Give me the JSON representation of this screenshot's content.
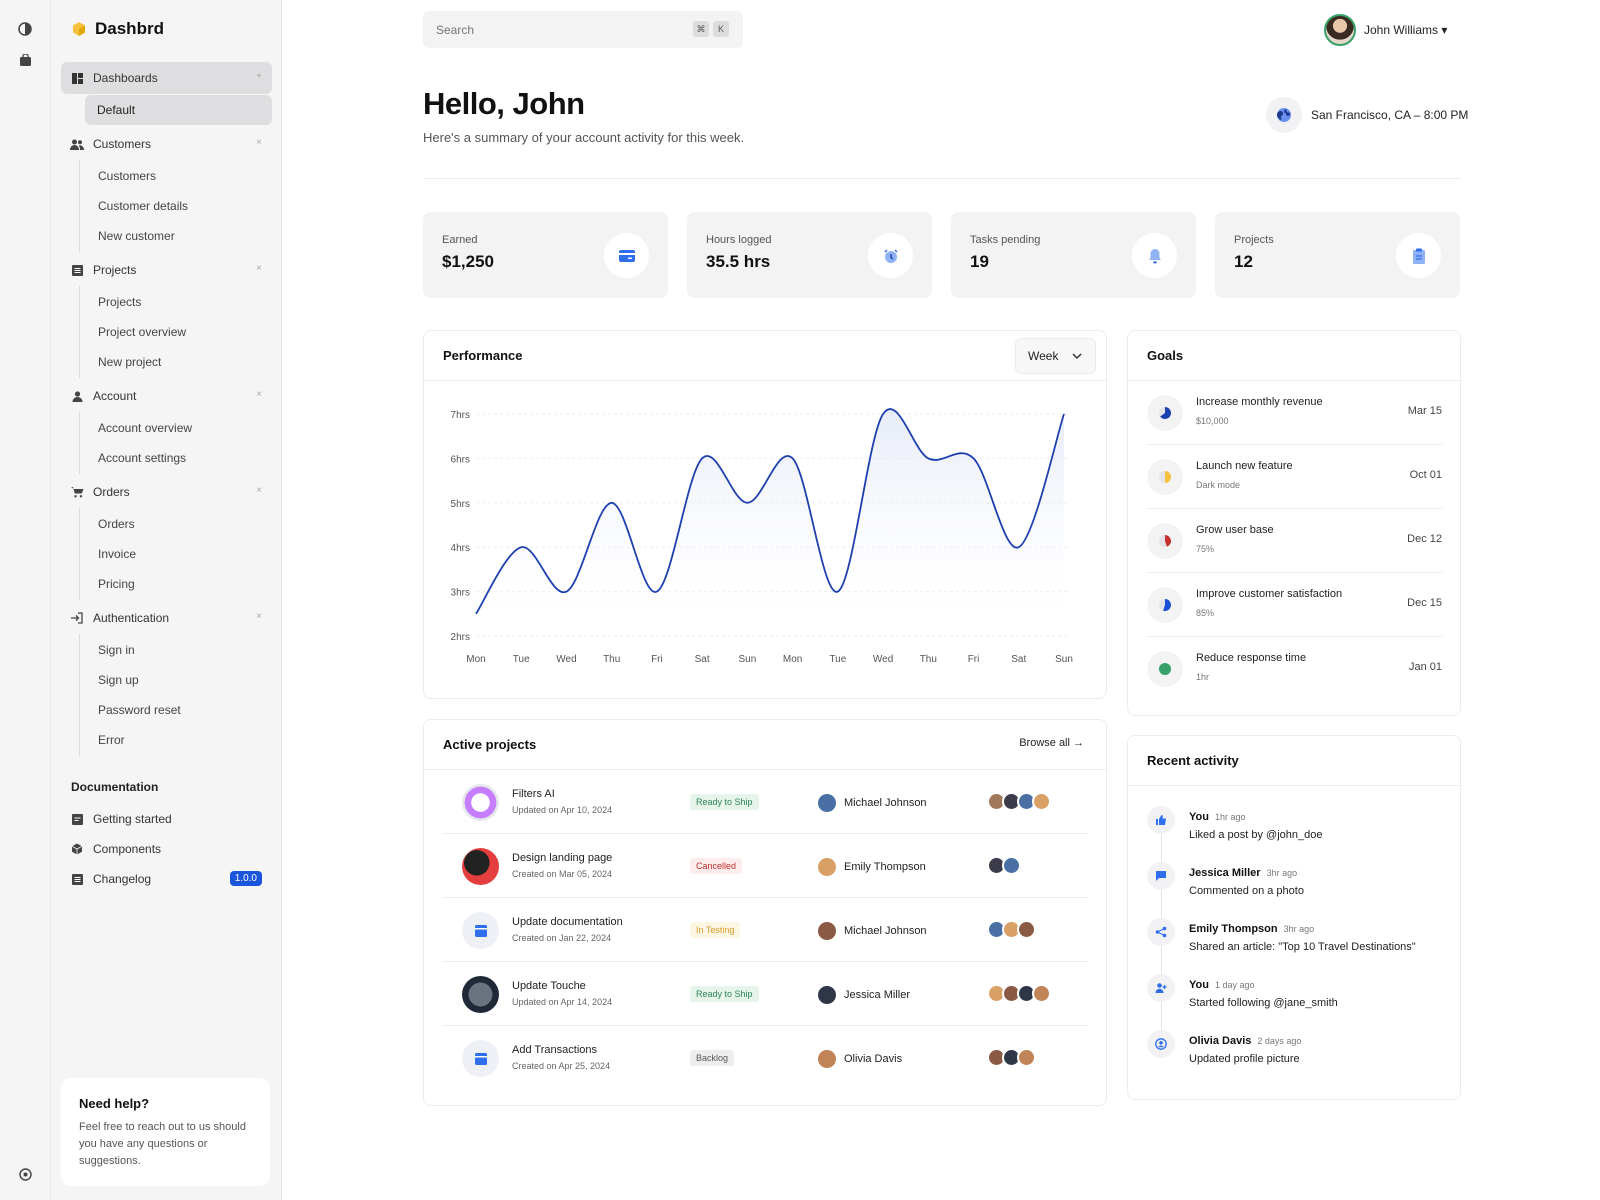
{
  "brand": {
    "name": "Dashbrd"
  },
  "search": {
    "placeholder": "Search",
    "key1": "⌘",
    "key2": "K"
  },
  "user": {
    "name": "John Williams ▾"
  },
  "sidebar": {
    "groups": [
      {
        "label": "Dashboards",
        "items": [
          "Default"
        ]
      },
      {
        "label": "Customers",
        "items": [
          "Customers",
          "Customer details",
          "New customer"
        ]
      },
      {
        "label": "Projects",
        "items": [
          "Projects",
          "Project overview",
          "New project"
        ]
      },
      {
        "label": "Account",
        "items": [
          "Account overview",
          "Account settings"
        ]
      },
      {
        "label": "Orders",
        "items": [
          "Orders",
          "Invoice",
          "Pricing"
        ]
      },
      {
        "label": "Authentication",
        "items": [
          "Sign in",
          "Sign up",
          "Password reset",
          "Error"
        ]
      }
    ],
    "docs_title": "Documentation",
    "docs": [
      "Getting started",
      "Components",
      "Changelog"
    ],
    "changelog_badge": "1.0.0",
    "help_title": "Need help?",
    "help_text": "Feel free to reach out to us should you have any questions or suggestions."
  },
  "header": {
    "title": "Hello, John",
    "subtitle": "Here's a summary of your account activity for this week.",
    "location": "San Francisco, CA – 8:00 PM"
  },
  "stats": [
    {
      "label": "Earned",
      "value": "$1,250",
      "icon": "card-icon"
    },
    {
      "label": "Hours logged",
      "value": "35.5 hrs",
      "icon": "clock-icon"
    },
    {
      "label": "Tasks pending",
      "value": "19",
      "icon": "bell-icon"
    },
    {
      "label": "Projects",
      "value": "12",
      "icon": "clipboard-icon"
    }
  ],
  "performance": {
    "title": "Performance",
    "range": "Week"
  },
  "chart_data": {
    "type": "line",
    "categories": [
      "Mon",
      "Tue",
      "Wed",
      "Thu",
      "Fri",
      "Sat",
      "Sun",
      "Mon",
      "Tue",
      "Wed",
      "Thu",
      "Fri",
      "Sat",
      "Sun"
    ],
    "values": [
      2.5,
      4,
      3,
      5,
      3,
      6,
      5,
      6,
      3,
      7,
      6,
      6,
      4,
      7
    ],
    "yticks": [
      "2hrs",
      "3hrs",
      "4hrs",
      "5hrs",
      "6hrs",
      "7hrs"
    ],
    "ylim": [
      2,
      7
    ],
    "color": "#1e40af"
  },
  "goals": {
    "title": "Goals",
    "items": [
      {
        "title": "Increase monthly revenue",
        "sub": "$10,000",
        "date": "Mar 15",
        "color": "#1e40af",
        "progress": 0.65
      },
      {
        "title": "Launch new feature",
        "sub": "Dark mode",
        "date": "Oct 01",
        "color": "#f6c23e",
        "progress": 0.5
      },
      {
        "title": "Grow user base",
        "sub": "75%",
        "date": "Dec 12",
        "color": "#c53030",
        "progress": 0.45
      },
      {
        "title": "Improve customer satisfaction",
        "sub": "85%",
        "date": "Dec 15",
        "color": "#1d4ed8",
        "progress": 0.55
      },
      {
        "title": "Reduce response time",
        "sub": "1hr",
        "date": "Jan 01",
        "color": "#38a169",
        "progress": 1
      }
    ]
  },
  "projects": {
    "title": "Active projects",
    "browse": "Browse all →",
    "rows": [
      {
        "name": "Filters AI",
        "date": "Updated on Apr 10, 2024",
        "status": "Ready to Ship",
        "status_color": "#2f855a",
        "status_bg": "#e6f4ea",
        "owner": "Michael Johnson",
        "team": 4
      },
      {
        "name": "Design landing page",
        "date": "Created on Mar 05, 2024",
        "status": "Cancelled",
        "status_color": "#c53030",
        "status_bg": "#fdecec",
        "owner": "Emily Thompson",
        "team": 2
      },
      {
        "name": "Update documentation",
        "date": "Created on Jan 22, 2024",
        "status": "In Testing",
        "status_color": "#d69e2e",
        "status_bg": "#fdf6e3",
        "owner": "Michael Johnson",
        "team": 3
      },
      {
        "name": "Update Touche",
        "date": "Updated on Apr 14, 2024",
        "status": "Ready to Ship",
        "status_color": "#2f855a",
        "status_bg": "#e6f4ea",
        "owner": "Jessica Miller",
        "team": 4
      },
      {
        "name": "Add Transactions",
        "date": "Created on Apr 25, 2024",
        "status": "Backlog",
        "status_color": "#555555",
        "status_bg": "#eeeeef",
        "owner": "Olivia Davis",
        "team": 3
      }
    ]
  },
  "activity": {
    "title": "Recent activity",
    "items": [
      {
        "name": "You",
        "time": "1hr ago",
        "text": "Liked a post by @john_doe",
        "icon": "thumbs-up-icon"
      },
      {
        "name": "Jessica Miller",
        "time": "3hr ago",
        "text": "Commented on a photo",
        "icon": "comment-icon"
      },
      {
        "name": "Emily Thompson",
        "time": "3hr ago",
        "text": "Shared an article: \"Top 10 Travel Destinations\"",
        "icon": "share-icon"
      },
      {
        "name": "You",
        "time": "1 day ago",
        "text": "Started following @jane_smith",
        "icon": "user-plus-icon"
      },
      {
        "name": "Olivia Davis",
        "time": "2 days ago",
        "text": "Updated profile picture",
        "icon": "user-circle-icon"
      }
    ]
  }
}
